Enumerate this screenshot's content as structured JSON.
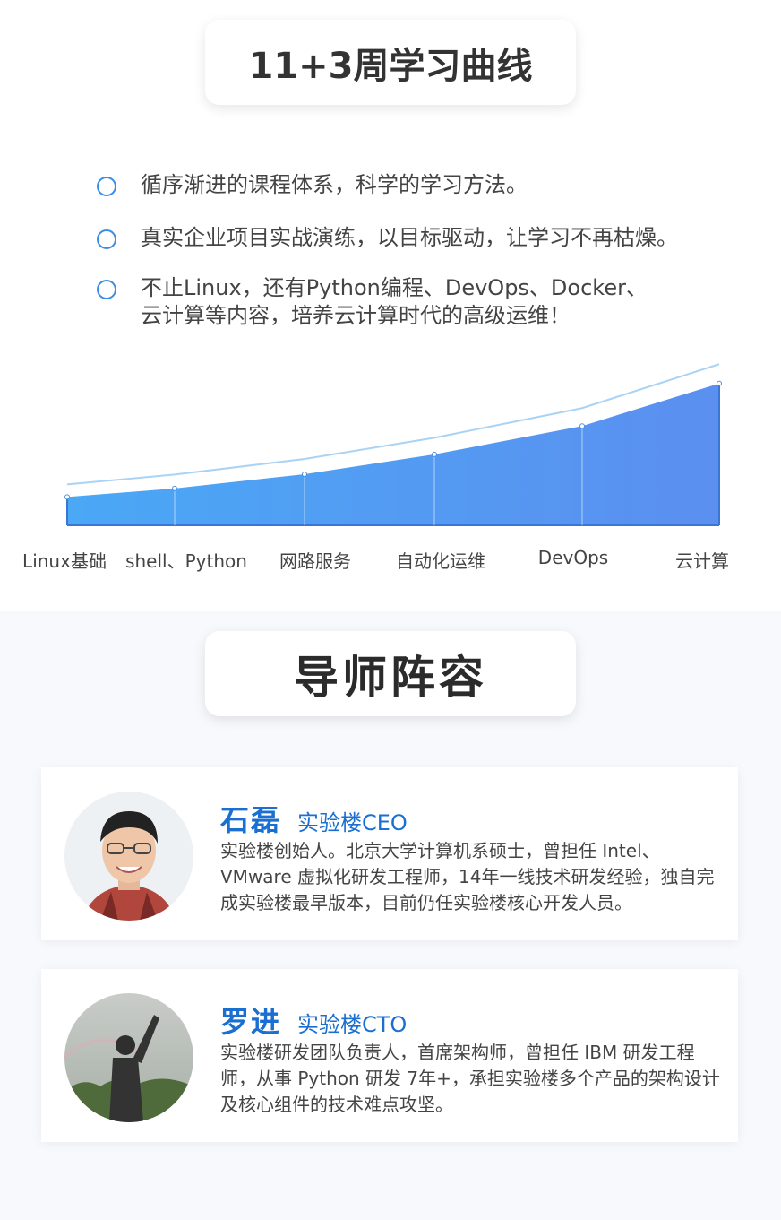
{
  "curve_section": {
    "title": "11+3周学习曲线",
    "bullets": [
      "循序渐进的课程体系，科学的学习方法。",
      "真实企业项目实战演练，以目标驱动，让学习不再枯燥。",
      "不止Linux，还有Python编程、DevOps、Docker、\n云计算等内容，培养云计算时代的高级运维！"
    ],
    "stages": [
      "Linux基础",
      "shell、Python",
      "网路服务",
      "自动化运维",
      "DevOps",
      "云计算"
    ],
    "colors": {
      "fill_top": "#5b8ff0",
      "fill_bottom": "#4aa8f5",
      "line": "#a9d3f5",
      "accent": "#3a8ee6"
    }
  },
  "chart_data": {
    "type": "area",
    "categories": [
      "Linux基础",
      "shell、Python",
      "网路服务",
      "自动化运维",
      "DevOps",
      "云计算"
    ],
    "values": [
      0.2,
      0.26,
      0.36,
      0.5,
      0.7,
      1.0
    ],
    "title": "",
    "xlabel": "",
    "ylabel": "",
    "grid": false
  },
  "mentor_section": {
    "title": "导师阵容",
    "mentors": [
      {
        "name": "石磊",
        "role": "实验楼CEO",
        "bio": "实验楼创始人。北京大学计算机系硕士，曾担任 Intel、VMware 虚拟化研发工程师，14年一线技术研发经验，独自完成实验楼最早版本，目前仍任实验楼核心开发人员。"
      },
      {
        "name": "罗进",
        "role": "实验楼CTO",
        "bio": "实验楼研发团队负责人，首席架构师，曾担任 IBM 研发工程师，从事 Python 研发 7年+，承担实验楼多个产品的架构设计及核心组件的技术难点攻坚。"
      }
    ],
    "name_color": "#1a6fd1"
  }
}
